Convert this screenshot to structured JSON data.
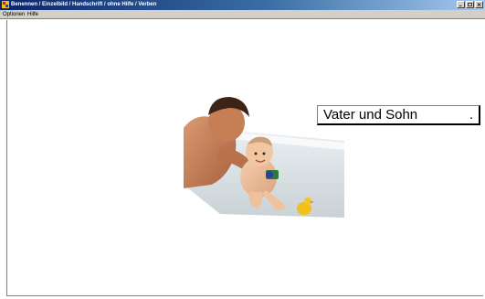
{
  "window": {
    "title": "Benennen / Einzelbild / Handschrift / ohne Hilfe / Verben",
    "buttons": [
      "minimize-icon",
      "maximize-icon",
      "close-icon"
    ]
  },
  "menu": {
    "items": [
      "Optionen",
      "Hilfe"
    ]
  },
  "exercise": {
    "image_description_icon": "father-and-baby-bath-image",
    "answer_text": "Vater und Sohn",
    "answer_end": "."
  },
  "colors": {
    "titlebar_start": "#0a246a",
    "titlebar_end": "#a6caf0",
    "menubar": "#d4d0c8",
    "background": "#ffffff"
  }
}
